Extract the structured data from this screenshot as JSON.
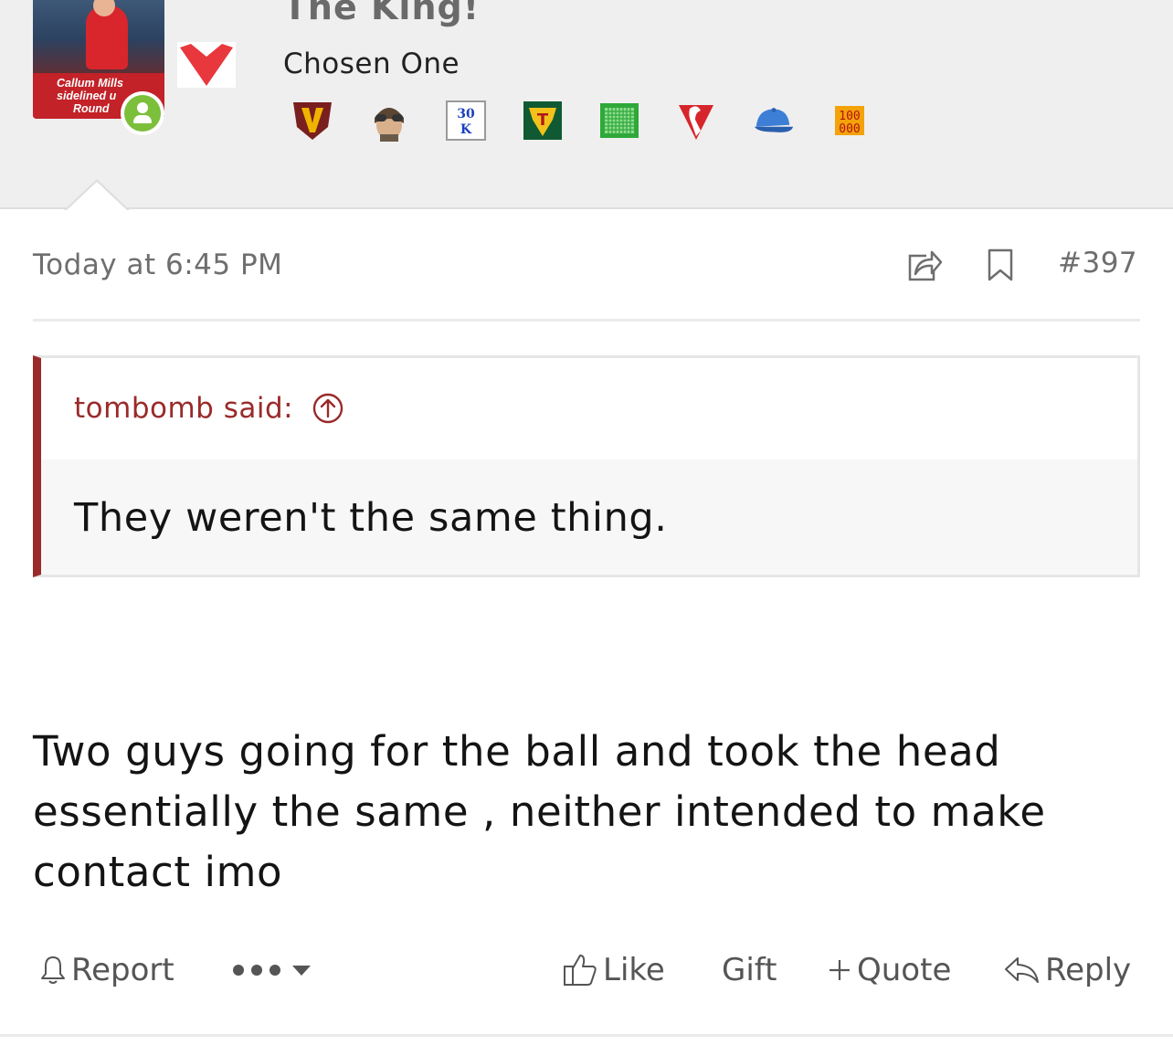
{
  "user": {
    "name": "The King!",
    "rank": "Chosen One",
    "avatar_caption": [
      "Callum Mills",
      "sidelined u",
      "Round"
    ],
    "online": true
  },
  "trophies": [
    {
      "icon": "v-shield-icon"
    },
    {
      "icon": "aviator-helmet-icon"
    },
    {
      "icon": "30k-badge-icon",
      "text": [
        "30",
        "K"
      ]
    },
    {
      "icon": "tasmania-t-icon",
      "text": [
        "T"
      ]
    },
    {
      "icon": "green-net-icon"
    },
    {
      "icon": "swans-logo-icon"
    },
    {
      "icon": "blue-cap-icon"
    },
    {
      "icon": "100000-badge-icon",
      "text": [
        "100",
        "000"
      ]
    }
  ],
  "post": {
    "time": "Today at 6:45 PM",
    "number": "#397"
  },
  "quote": {
    "author": "tombomb said:",
    "text": "They weren't the same thing."
  },
  "message": {
    "lines": [
      "Two guys going for the ball and took the head",
      "essentially the same , neither intended to make",
      "contact imo"
    ]
  },
  "actions": {
    "report": "Report",
    "like": "Like",
    "gift": "Gift",
    "quote": "Quote",
    "reply": "Reply"
  },
  "colors": {
    "band_bg": "#efefef",
    "quote_accent": "#9a2a2a",
    "heart": "#e8383d",
    "online": "#7bbf3b",
    "muted_text": "#6e6e6e"
  }
}
